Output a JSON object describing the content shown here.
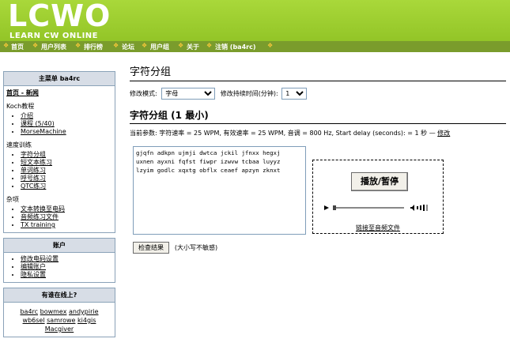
{
  "header": {
    "logo": "LCWO",
    "tagline": "LEARN CW ONLINE"
  },
  "nav": {
    "items": [
      "首页",
      "用户列表",
      "排行榜",
      "论坛",
      "用户组",
      "关于",
      "注销 (ba4rc)"
    ]
  },
  "sidebar": {
    "main_menu": {
      "title": "主菜单 ba4rc",
      "home_news": "首页 - 新闻",
      "koch_label": "Koch教程",
      "koch_items": [
        "介绍",
        "课程 (5/40)",
        "MorseMachine"
      ],
      "speed_label": "速度训练",
      "speed_items": [
        "字符分组",
        "短文本练习",
        "单词练习",
        "呼号练习",
        "QTC练习"
      ],
      "misc_label": "杂项",
      "misc_items": [
        "文本转换至电码",
        "音频练习文件",
        "TX training"
      ]
    },
    "account": {
      "title": "账户",
      "items": [
        "修改电码设置",
        "编辑账户",
        "隐私设置"
      ]
    },
    "online": {
      "title": "有谁在线上?",
      "users": [
        "ba4rc",
        "bowmex",
        "andypirie",
        "wb6sel",
        "samrowe",
        "ki4gis",
        "Macgiver"
      ]
    }
  },
  "main": {
    "title": "字符分组",
    "mode_label": "修改模式:",
    "mode_value": "字母",
    "duration_label": "修改持续时间(分钟):",
    "duration_value": "1",
    "section_title": "字符分组 (1 最小)",
    "params": "当前参数: 字符速率 = 25 WPM, 有效速率 = 25 WPM, 音调 = 800 Hz, Start delay (seconds): = 1 秒 —",
    "params_link": "修改",
    "groups_text": "gjqfn adkpn ujmji dwtca jckil jfnxx hegxj\nuxnen ayxni fqfst fiwpr izwvw tcbaa luyyz\nlzyim godlc xqxtg obflx ceaef apzyn zknxt",
    "play_button": "播放/暂停",
    "download_link": "链接至音频文件",
    "check_button": "检查结果",
    "check_note": "(大小写不敏感)"
  }
}
